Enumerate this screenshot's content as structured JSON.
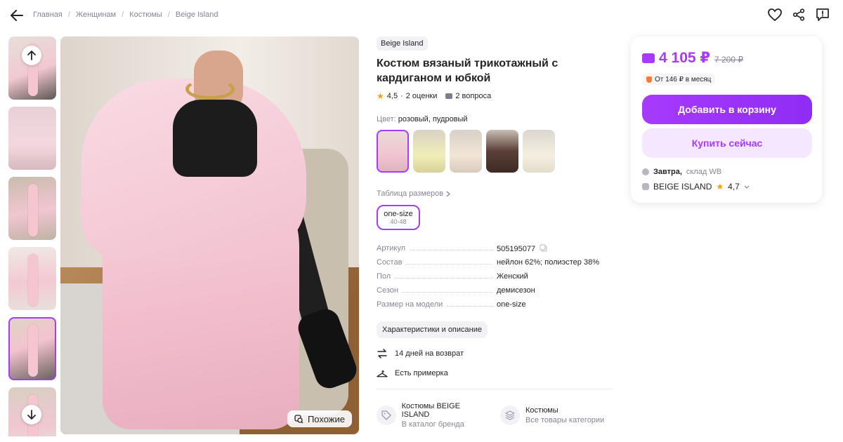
{
  "breadcrumb": [
    "Главная",
    "Женщинам",
    "Костюмы",
    "Beige Island"
  ],
  "similar_label": "Похожие",
  "product": {
    "brand": "Beige Island",
    "title": "Костюм вязаный трикотажный с кардиганом и юбкой",
    "rating": "4,5",
    "rating_separator": "·",
    "reviews": "2 оценки",
    "questions": "2 вопроса",
    "color_label": "Цвет:",
    "color_value": "розовый, пудровый",
    "size_table_label": "Таблица размеров",
    "size": {
      "name": "one-size",
      "range": "40-48"
    },
    "specs": [
      {
        "key": "Артикул",
        "value": "505195077"
      },
      {
        "key": "Состав",
        "value": "нейлон 62%; полиэстер 38%"
      },
      {
        "key": "Пол",
        "value": "Женский"
      },
      {
        "key": "Сезон",
        "value": "демисезон"
      },
      {
        "key": "Размер на модели",
        "value": "one-size"
      }
    ],
    "description_button": "Характеристики и описание",
    "features": [
      {
        "icon": "return-icon",
        "label": "14 дней на возврат"
      },
      {
        "icon": "hanger-icon",
        "label": "Есть примерка"
      }
    ],
    "links": [
      {
        "icon": "tag-icon",
        "title": "Костюмы BEIGE ISLAND",
        "subtitle": "В каталог бренда"
      },
      {
        "icon": "layers-icon",
        "title": "Костюмы",
        "subtitle": "Все товары категории"
      }
    ]
  },
  "price_card": {
    "price": "4 105 ₽",
    "old_price": "7 200 ₽",
    "installment": "От 146 ₽ в месяц",
    "add_to_cart": "Добавить в корзину",
    "buy_now": "Купить сейчас",
    "delivery_day": "Завтра,",
    "delivery_place": "склад WB",
    "seller_name": "BEIGE ISLAND",
    "seller_rating": "4,7"
  },
  "colors": {
    "accent": "#a73afd",
    "accent_light": "#f5e7ff",
    "star": "#ff9d00"
  }
}
